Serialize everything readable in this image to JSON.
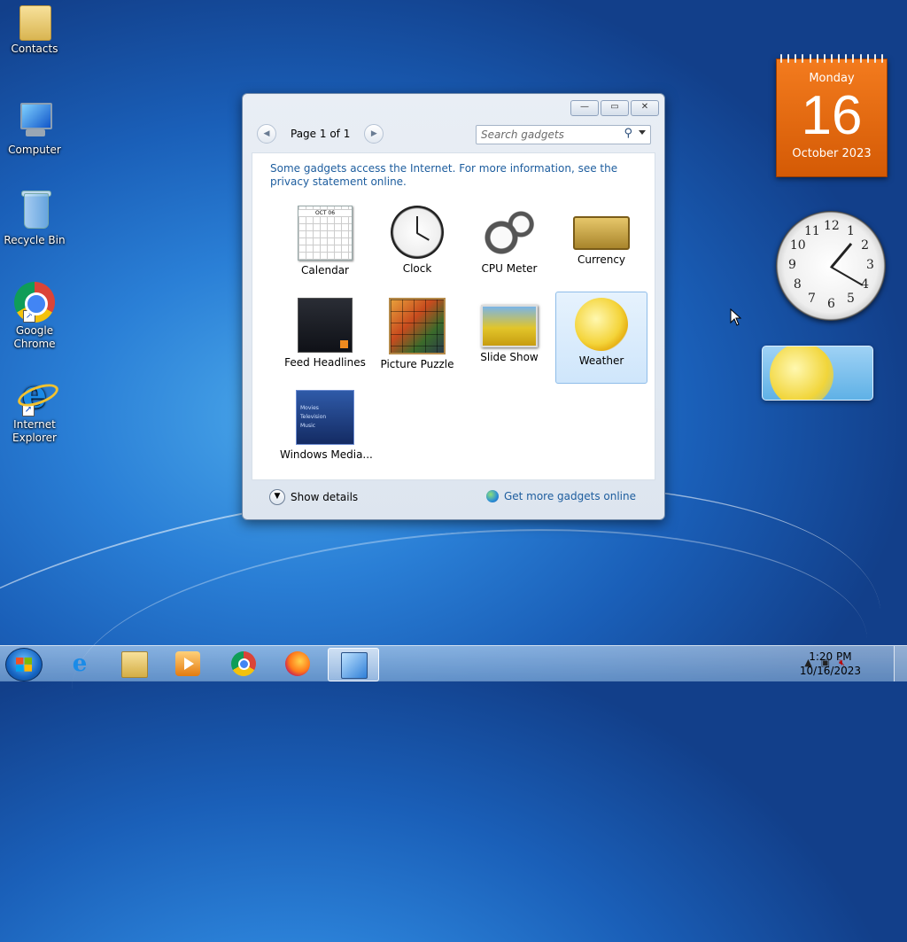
{
  "desktop": {
    "icons": [
      {
        "label": "Contacts"
      },
      {
        "label": "Computer"
      },
      {
        "label": "Recycle Bin"
      },
      {
        "label": "Google Chrome"
      },
      {
        "label": "Internet Explorer"
      }
    ]
  },
  "calendar_gadget": {
    "day": "Monday",
    "date": "16",
    "month_year": "October 2023",
    "color": "#e8670f"
  },
  "clock_gadget": {
    "numbers": [
      "12",
      "1",
      "2",
      "3",
      "4",
      "5",
      "6",
      "7",
      "8",
      "9",
      "10",
      "11"
    ],
    "time_shown": "1:20"
  },
  "gadget_window": {
    "pager": {
      "prev_icon": "chevron-left-icon",
      "label": "Page 1 of 1",
      "next_icon": "chevron-right-icon"
    },
    "search": {
      "placeholder": "Search gadgets"
    },
    "info_text": "Some gadgets access the Internet.  For more information, see the privacy statement online.",
    "gadgets": [
      {
        "name": "Calendar"
      },
      {
        "name": "Clock"
      },
      {
        "name": "CPU Meter"
      },
      {
        "name": "Currency"
      },
      {
        "name": "Feed Headlines"
      },
      {
        "name": "Picture Puzzle"
      },
      {
        "name": "Slide Show"
      },
      {
        "name": "Weather",
        "selected": true
      },
      {
        "name": "Windows Media..."
      }
    ],
    "calendar_thumb_month": "OCT 06",
    "wmc_thumb_lines": [
      "Movies",
      "Television",
      "Music"
    ],
    "show_details": "Show details",
    "get_more": "Get more gadgets online"
  },
  "taskbar": {
    "time": "1:20 PM",
    "date": "10/16/2023",
    "apps": [
      "Internet Explorer",
      "Windows Explorer",
      "Windows Media Player",
      "Google Chrome",
      "Firefox",
      "Gadgets"
    ]
  }
}
